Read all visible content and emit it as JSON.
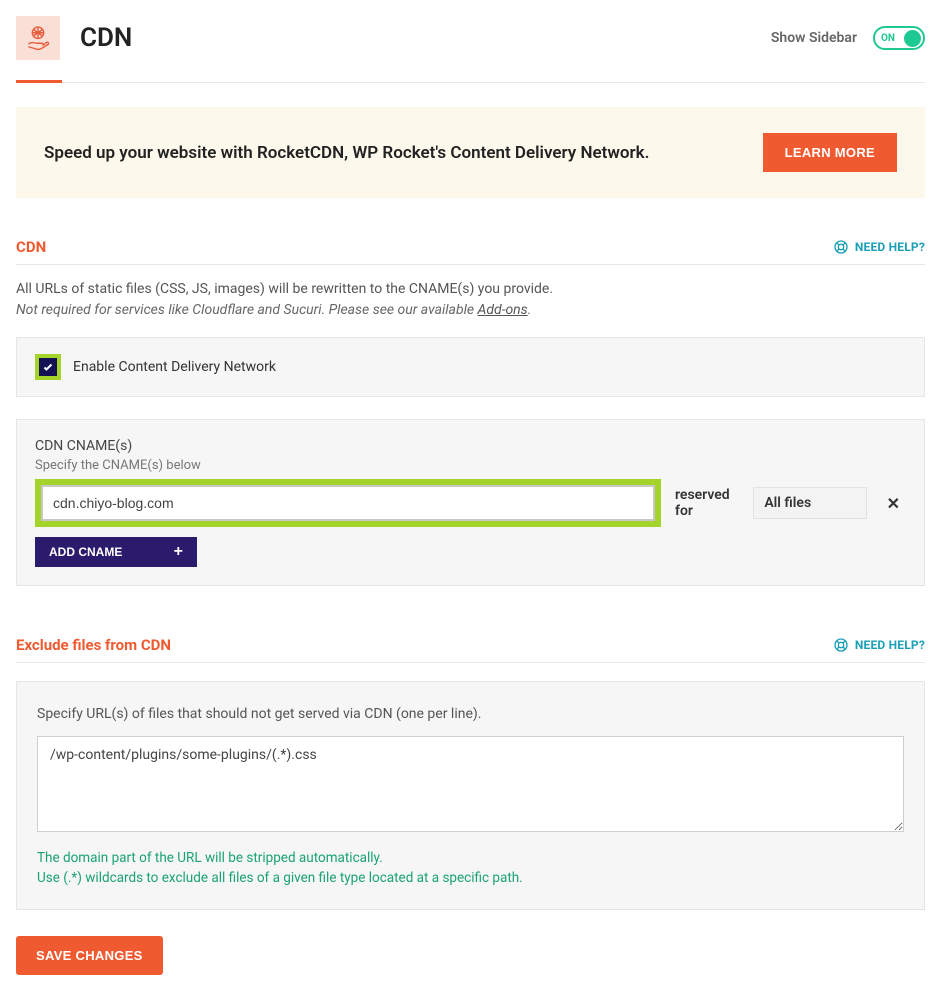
{
  "header": {
    "title": "CDN",
    "show_sidebar_label": "Show Sidebar",
    "toggle_label": "ON"
  },
  "promo": {
    "text": "Speed up your website with RocketCDN, WP Rocket's Content Delivery Network.",
    "button": "LEARN MORE"
  },
  "cdn_section": {
    "title": "CDN",
    "help_label": "NEED HELP?",
    "desc_line1": "All URLs of static files (CSS, JS, images) will be rewritten to the CNAME(s) you provide.",
    "desc_line2_prefix": "Not required for services like Cloudflare and Sucuri. Please see our available ",
    "desc_line2_link": "Add-ons",
    "desc_line2_suffix": ".",
    "enable_label": "Enable Content Delivery Network"
  },
  "cname_panel": {
    "title": "CDN CNAME(s)",
    "subdesc": "Specify the CNAME(s) below",
    "input_value": "cdn.chiyo-blog.com",
    "reserved_label": "reserved for",
    "select_value": "All files",
    "remove_glyph": "✕",
    "add_button": "ADD CNAME",
    "add_plus": "+"
  },
  "exclude_section": {
    "title": "Exclude files from CDN",
    "help_label": "NEED HELP?",
    "desc": "Specify URL(s) of files that should not get served via CDN (one per line).",
    "textarea_value": "/wp-content/plugins/some-plugins/(.*).css",
    "hint1": "The domain part of the URL will be stripped automatically.",
    "hint2": "Use (.*) wildcards to exclude all files of a given file type located at a specific path."
  },
  "footer": {
    "save_label": "SAVE CHANGES"
  }
}
